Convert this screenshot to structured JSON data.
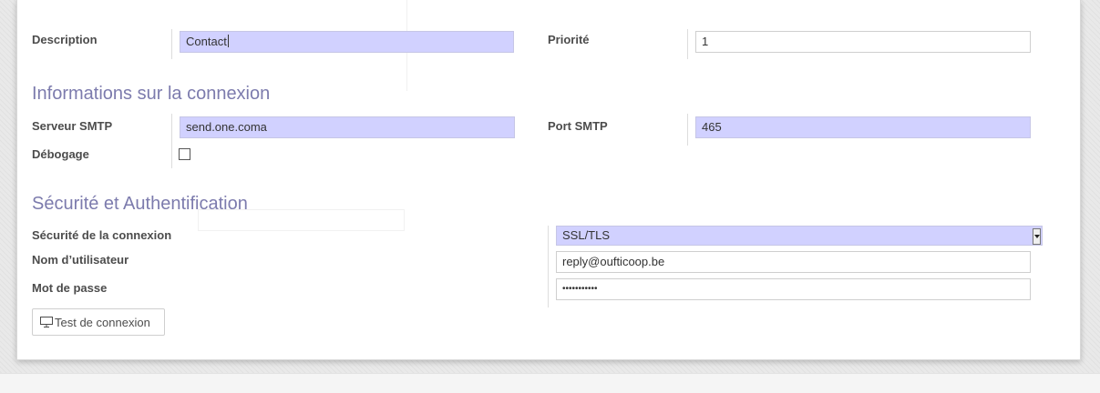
{
  "form": {
    "description_label": "Description",
    "description_value": "Contact",
    "priority_label": "Priorité",
    "priority_value": "1"
  },
  "connection": {
    "title": "Informations sur la connexion",
    "smtp_server_label": "Serveur SMTP",
    "smtp_server_value": "send.one.coma",
    "smtp_port_label": "Port SMTP",
    "smtp_port_value": "465",
    "debug_label": "Débogage",
    "debug_checked": false
  },
  "security": {
    "title": "Sécurité et Authentification",
    "encryption_label": "Sécurité de la connexion",
    "encryption_value": "SSL/TLS",
    "username_label": "Nom d’utilisateur",
    "username_value": "reply@oufticoop.be",
    "password_label": "Mot de passe",
    "password_value": "•••••••••••",
    "test_button_label": "Test de connexion"
  },
  "colors": {
    "required_field_bg": "#d1d1ff",
    "section_title": "#7c7bad"
  }
}
